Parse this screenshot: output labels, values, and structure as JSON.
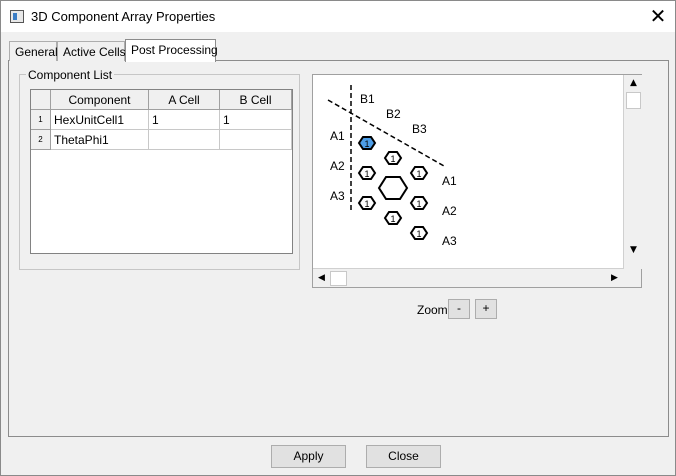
{
  "window": {
    "title": "3D Component Array Properties",
    "close_glyph": "✕"
  },
  "tabs": [
    {
      "label": "General",
      "active": false
    },
    {
      "label": "Active Cells",
      "active": false
    },
    {
      "label": "Post Processing",
      "active": true
    }
  ],
  "component_list": {
    "label": "Component List",
    "columns": [
      "Component",
      "A Cell",
      "B Cell"
    ],
    "rows": [
      {
        "num": "1",
        "component": "HexUnitCell1",
        "a_cell": "1",
        "b_cell": "1"
      },
      {
        "num": "2",
        "component": "ThetaPhi1",
        "a_cell": "",
        "b_cell": ""
      }
    ]
  },
  "diagram": {
    "b_labels": [
      "B1",
      "B2",
      "B3"
    ],
    "a_left_labels": [
      "A1",
      "A2",
      "A3"
    ],
    "a_right_labels": [
      "A1",
      "A2",
      "A3"
    ],
    "cell_glyph": "1",
    "selected_color": "#4d9ee8"
  },
  "zoom": {
    "label": "Zoom",
    "minus": "-",
    "plus": "+"
  },
  "buttons": {
    "apply": "Apply",
    "close": "Close"
  },
  "scroll_arrows": {
    "up": "▲",
    "down": "▼",
    "left": "◀",
    "right": "▶"
  }
}
